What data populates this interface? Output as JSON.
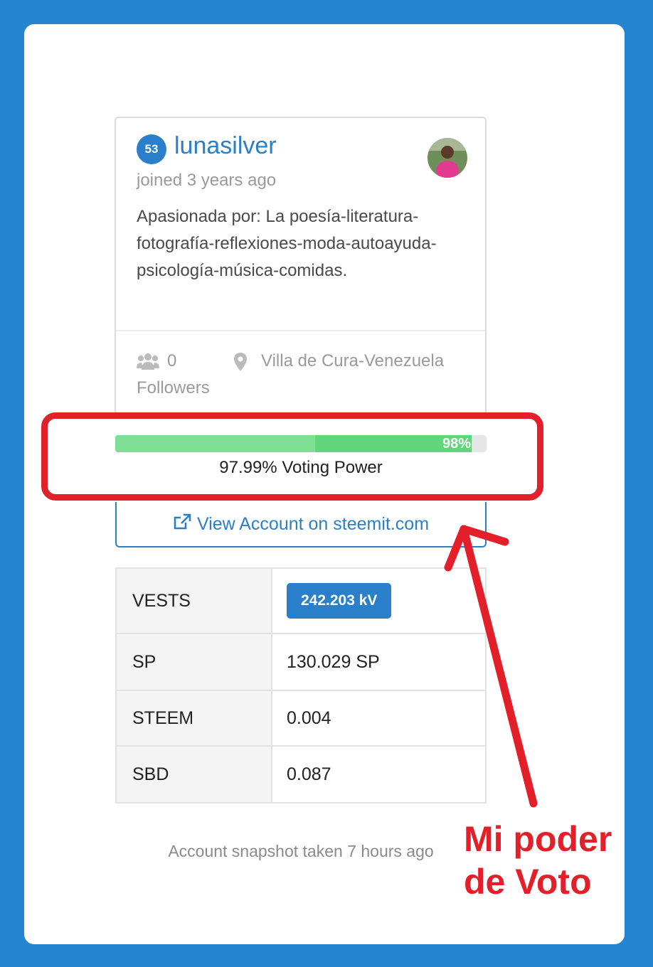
{
  "profile": {
    "reputation": "53",
    "username": "lunasilver",
    "joined": "joined 3 years ago",
    "bio": "Apasionada por: La poesía-literatura-fotografía-reflexiones-moda-autoayuda-psicología-música-comidas.",
    "followers_count": "0",
    "followers_label": "Followers",
    "location": "Villa de Cura-Venezuela"
  },
  "voting_power": {
    "value": 0.9799,
    "bar_label": "98%",
    "text": "97.99% Voting Power"
  },
  "view_account_label": "View Account on steemit.com",
  "stats": [
    {
      "key": "VESTS",
      "value": "242.203 kV"
    },
    {
      "key": "SP",
      "value": "130.029 SP"
    },
    {
      "key": "STEEM",
      "value": "0.004"
    },
    {
      "key": "SBD",
      "value": "0.087"
    }
  ],
  "snapshot_text": "Account snapshot taken 7 hours ago",
  "annotation": {
    "line1": "Mi poder",
    "line2": "de Voto"
  },
  "colors": {
    "background": "#2585d0",
    "accent": "#2a7fcb",
    "bar_fill": "#62d67b",
    "annotation": "#e3202a"
  },
  "icons": {
    "followers": "users-icon",
    "location": "map-pin-icon",
    "external_link": "external-link-icon"
  }
}
